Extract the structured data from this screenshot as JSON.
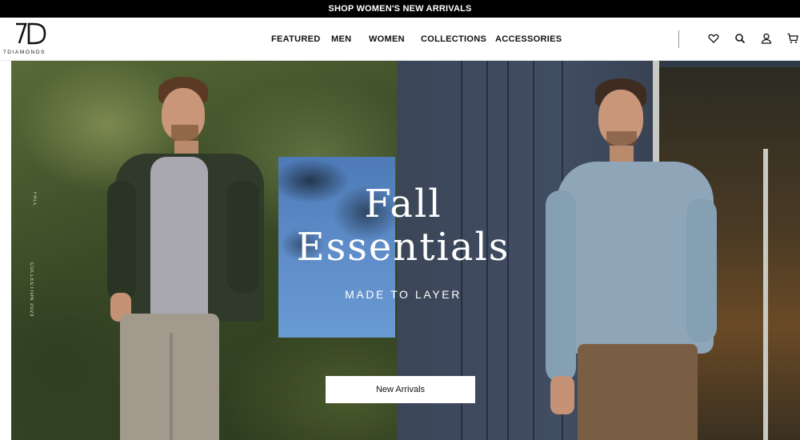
{
  "announcement": {
    "text": "SHOP WOMEN'S NEW ARRIVALS"
  },
  "brand": {
    "logo_mark": "7D",
    "logo_word": "7DIAMONDS"
  },
  "nav": {
    "items": [
      {
        "label": "FEATURED"
      },
      {
        "label": "MEN"
      },
      {
        "label": "WOMEN"
      },
      {
        "label": "COLLECTIONS"
      },
      {
        "label": "ACCESSORIES"
      }
    ]
  },
  "header_icons": [
    "heart-icon",
    "search-icon",
    "user-icon",
    "cart-icon"
  ],
  "hero": {
    "title_line1": "Fall",
    "title_line2": "Essentials",
    "subtitle": "MADE TO LAYER",
    "cta_label": "New Arrivals",
    "side_label_top": "FALL",
    "side_label_bottom": "COLLECTION 2023"
  },
  "colors": {
    "announce_bg": "#000000",
    "text": "#111111",
    "hero_text": "#ffffff",
    "sky_blue": "#5d8cc8"
  }
}
